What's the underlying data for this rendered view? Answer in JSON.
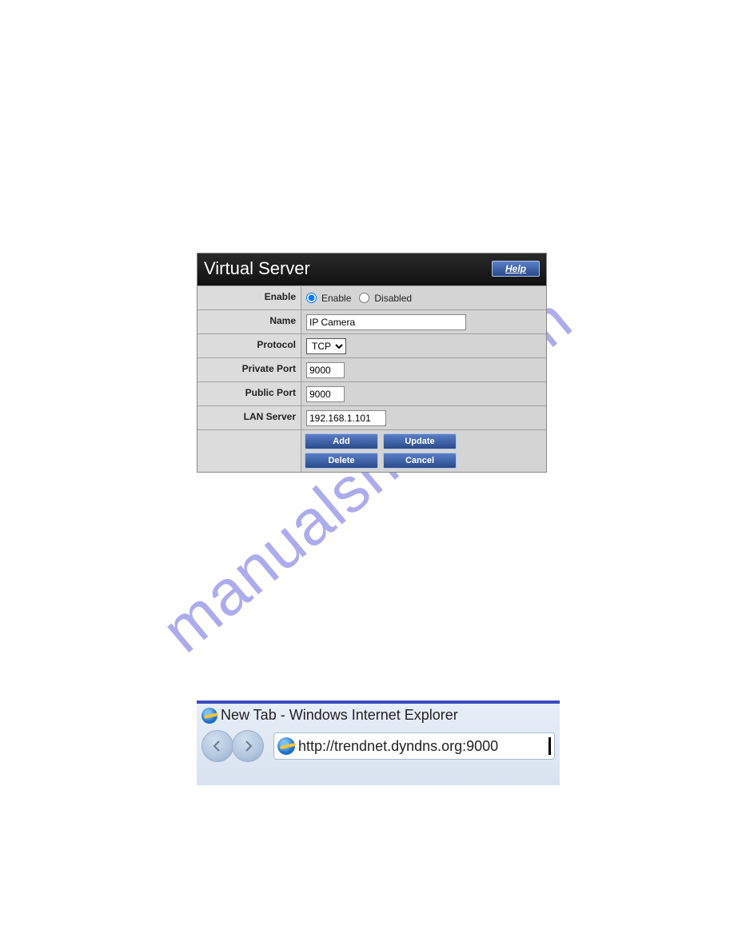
{
  "watermark": "manualshive.com",
  "vs": {
    "title": "Virtual Server",
    "help_label": "Help",
    "rows": {
      "enable_label": "Enable",
      "enable_opt1": "Enable",
      "enable_opt2": "Disabled",
      "name_label": "Name",
      "name_value": "IP Camera",
      "protocol_label": "Protocol",
      "protocol_value": "TCP",
      "private_port_label": "Private Port",
      "private_port_value": "9000",
      "public_port_label": "Public Port",
      "public_port_value": "9000",
      "lan_server_label": "LAN Server",
      "lan_server_value": "192.168.1.101"
    },
    "buttons": {
      "add": "Add",
      "update": "Update",
      "delete": "Delete",
      "cancel": "Cancel"
    }
  },
  "ie": {
    "title": "New Tab - Windows Internet Explorer",
    "url": "http://trendnet.dyndns.org:9000"
  }
}
